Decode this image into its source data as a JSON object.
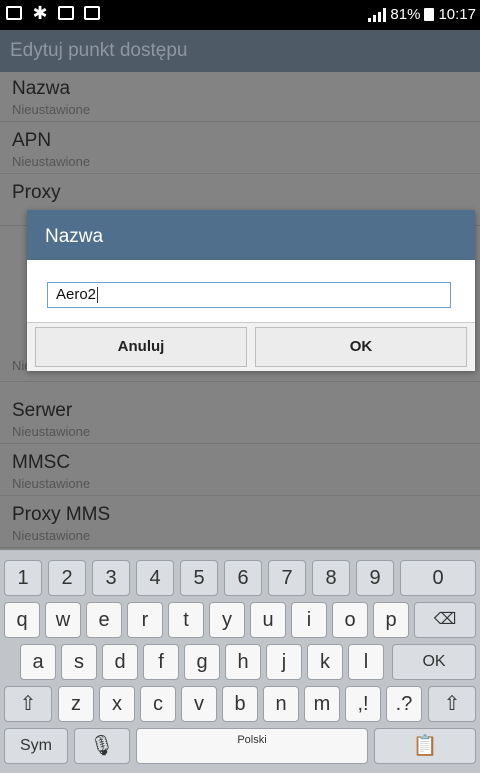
{
  "status_bar": {
    "battery_pct": "81%",
    "time": "10:17"
  },
  "app_bar": {
    "title": "Edytuj punkt dostępu"
  },
  "settings_list": [
    {
      "title": "Nazwa",
      "subtitle": "Nieustawione"
    },
    {
      "title": "APN",
      "subtitle": "Nieustawione"
    },
    {
      "title": "Proxy",
      "subtitle": ""
    },
    {
      "title": "",
      "subtitle": "Nieustawione"
    },
    {
      "title": "Serwer",
      "subtitle": "Nieustawione"
    },
    {
      "title": "MMSC",
      "subtitle": "Nieustawione"
    },
    {
      "title": "Proxy MMS",
      "subtitle": "Nieustawione"
    }
  ],
  "dialog": {
    "title": "Nazwa",
    "input_value": "Aero2",
    "cancel_label": "Anuluj",
    "ok_label": "OK"
  },
  "keyboard": {
    "row1": [
      "1",
      "2",
      "3",
      "4",
      "5",
      "6",
      "7",
      "8",
      "9",
      "0"
    ],
    "row2": [
      "q",
      "w",
      "e",
      "r",
      "t",
      "y",
      "u",
      "i",
      "o",
      "p"
    ],
    "row3": [
      "a",
      "s",
      "d",
      "f",
      "g",
      "h",
      "j",
      "k",
      "l"
    ],
    "row3_action": "OK",
    "row4": [
      "z",
      "x",
      "c",
      "v",
      "b",
      "n",
      "m",
      ",!",
      ".?"
    ],
    "sym_label": "Sym",
    "space_label": "Polski"
  }
}
